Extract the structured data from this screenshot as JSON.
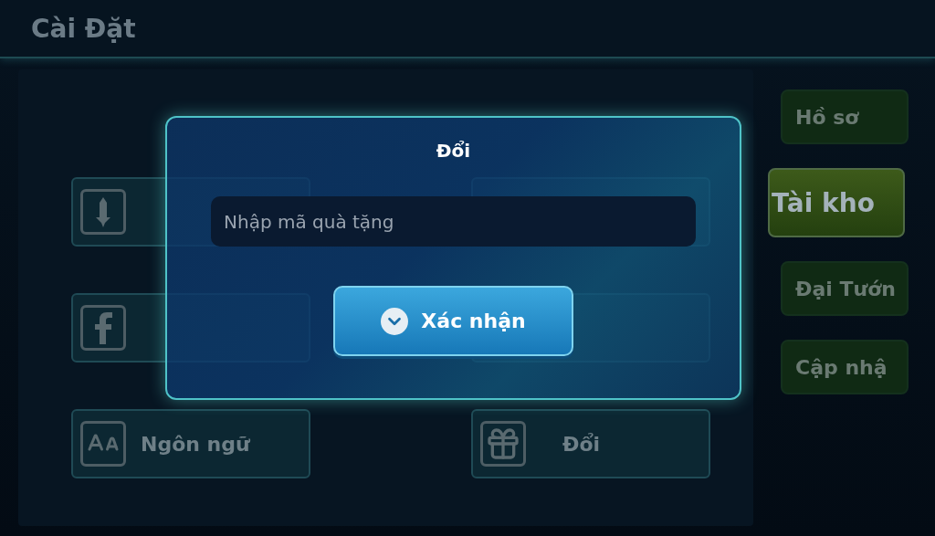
{
  "screen": {
    "title": "Cài Đặt"
  },
  "options": [
    {
      "kind": "covered"
    },
    {
      "kind": "covered"
    },
    {
      "kind": "covered"
    },
    {
      "kind": "covered"
    },
    {
      "kind": "labeled",
      "label": "Ngôn ngữ"
    },
    {
      "kind": "labeled",
      "label": "Đổi"
    }
  ],
  "sidebar": {
    "items": [
      {
        "label": "Hồ sơ",
        "selected": false
      },
      {
        "label": "Tài kho",
        "selected": true
      },
      {
        "label": "Đại Tướn",
        "selected": false
      },
      {
        "label": "Cập nhậ",
        "selected": false
      }
    ]
  },
  "dialog": {
    "title": "Đổi",
    "code_field": {
      "placeholder": "Nhập mã quà tặng"
    },
    "confirm_button": "Xác nhận"
  }
}
